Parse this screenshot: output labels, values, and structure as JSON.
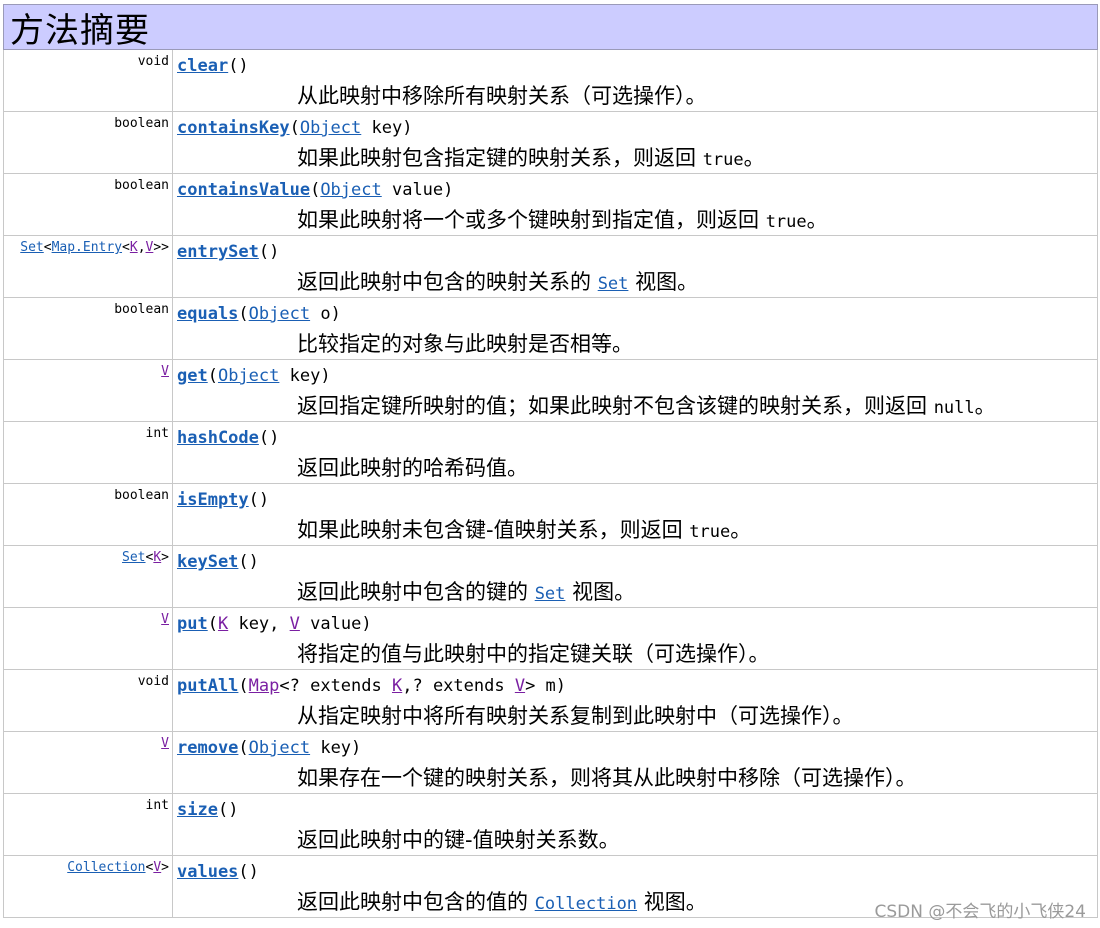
{
  "header": {
    "title": "方法摘要"
  },
  "rows": [
    {
      "type_text": "void",
      "method": "clear",
      "sig_open": "()",
      "params_text": "",
      "sig_close": "",
      "desc": "从此映射中移除所有映射关系（可选操作）。",
      "desc_code": "",
      "desc_tail": ""
    },
    {
      "type_text": "boolean",
      "method": "containsKey",
      "sig_open": "(",
      "param_type": "Object",
      "params_text": " key",
      "sig_close": ")",
      "desc": "如果此映射包含指定键的映射关系，则返回 ",
      "desc_code": "true",
      "desc_tail": "。"
    },
    {
      "type_text": "boolean",
      "method": "containsValue",
      "sig_open": "(",
      "param_type": "Object",
      "params_text": " value",
      "sig_close": ")",
      "desc": "如果此映射将一个或多个键映射到指定值，则返回 ",
      "desc_code": "true",
      "desc_tail": "。"
    },
    {
      "type_set": "Set",
      "type_lt": "<",
      "type_inner": "Map.Entry",
      "type_lt2": "<",
      "type_k": "K",
      "type_comma": ",",
      "type_v": "V",
      "type_gt": ">>",
      "method": "entrySet",
      "sig_open": "()",
      "desc": "返回此映射中包含的映射关系的 ",
      "desc_code": "Set",
      "desc_tail": " 视图。"
    },
    {
      "type_text": "boolean",
      "method": "equals",
      "sig_open": "(",
      "param_type": "Object",
      "params_text": " o",
      "sig_close": ")",
      "desc": "比较指定的对象与此映射是否相等。",
      "desc_code": "",
      "desc_tail": ""
    },
    {
      "type_v": "V",
      "method": "get",
      "sig_open": "(",
      "param_type": "Object",
      "params_text": " key",
      "sig_close": ")",
      "desc": "返回指定键所映射的值；如果此映射不包含该键的映射关系，则返回 ",
      "desc_code": "null",
      "desc_tail": "。"
    },
    {
      "type_text": "int",
      "method": "hashCode",
      "sig_open": "()",
      "desc": "返回此映射的哈希码值。",
      "desc_code": "",
      "desc_tail": ""
    },
    {
      "type_text": "boolean",
      "method": "isEmpty",
      "sig_open": "()",
      "desc": "如果此映射未包含键-值映射关系，则返回 ",
      "desc_code": "true",
      "desc_tail": "。"
    },
    {
      "type_set": "Set",
      "type_lt": "<",
      "type_k": "K",
      "type_gt": ">",
      "method": "keySet",
      "sig_open": "()",
      "desc": "返回此映射中包含的键的 ",
      "desc_code": "Set",
      "desc_tail": " 视图。"
    },
    {
      "type_v": "V",
      "method": "put",
      "sig_open": "(",
      "p1_type": "K",
      "p1_name": " key, ",
      "p2_type": "V",
      "p2_name": " value",
      "sig_close": ")",
      "desc": "将指定的值与此映射中的指定键关联（可选操作）。",
      "desc_code": "",
      "desc_tail": ""
    },
    {
      "type_text": "void",
      "method": "putAll",
      "sig_open": "(",
      "p_map": "Map",
      "p_mid1": "<? extends ",
      "p_k": "K",
      "p_mid2": ",? extends ",
      "p_v": "V",
      "p_end": "> m",
      "sig_close": ")",
      "desc": "从指定映射中将所有映射关系复制到此映射中（可选操作）。",
      "desc_code": "",
      "desc_tail": ""
    },
    {
      "type_v": "V",
      "method": "remove",
      "sig_open": "(",
      "param_type": "Object",
      "params_text": " key",
      "sig_close": ")",
      "desc": "如果存在一个键的映射关系，则将其从此映射中移除（可选操作）。",
      "desc_code": "",
      "desc_tail": ""
    },
    {
      "type_text": "int",
      "method": "size",
      "sig_open": "()",
      "desc": "返回此映射中的键-值映射关系数。",
      "desc_code": "",
      "desc_tail": ""
    },
    {
      "type_set": "Collection",
      "type_lt": "<",
      "type_v": "V",
      "type_gt": ">",
      "method": "values",
      "sig_open": "()",
      "desc": "返回此映射中包含的值的 ",
      "desc_code": "Collection",
      "desc_tail": " 视图。"
    }
  ],
  "watermark": "CSDN @不会飞的小飞侠24"
}
